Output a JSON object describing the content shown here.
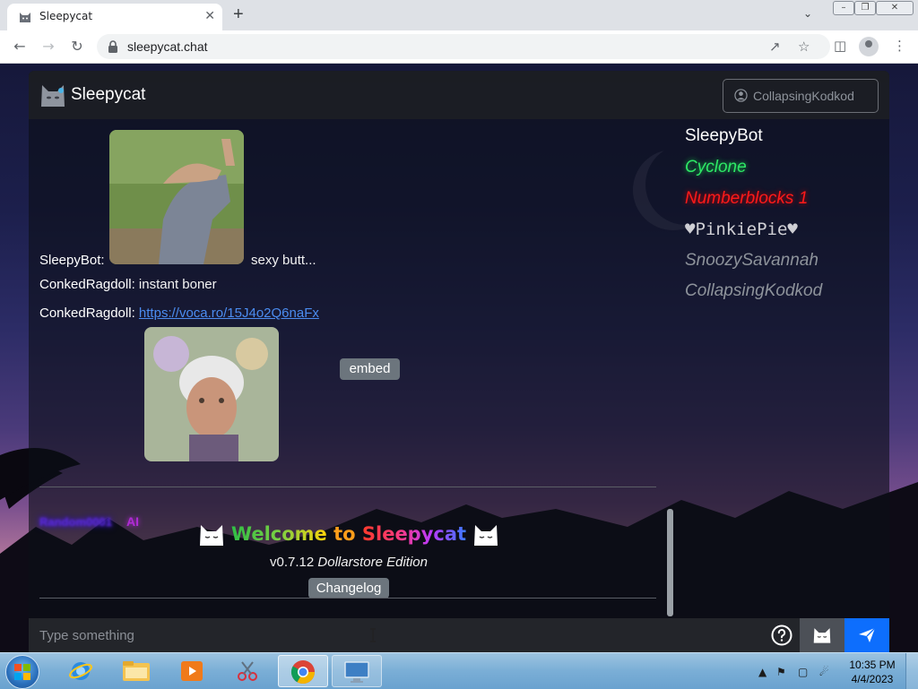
{
  "browser": {
    "tab_title": "Sleepycat",
    "tab_close": "✕",
    "new_tab": "+",
    "url": "sleepycat.chat",
    "window_controls": [
      "–",
      "❐",
      "✕"
    ]
  },
  "app": {
    "brand": "Sleepycat",
    "current_user": "CollapsingKodkod",
    "messages": [
      {
        "name": "SleepyBot:",
        "text": "sexy butt..."
      },
      {
        "name": "ConkedRagdoll:",
        "text": "instant boner"
      },
      {
        "name": "ConkedRagdoll:",
        "link": "https://voca.ro/15J4o2Q6naFx",
        "button": "embed"
      }
    ],
    "blurred_user_suffix": "AI",
    "welcome": {
      "title_parts": [
        "Welcome",
        " to ",
        "Sleepycat"
      ],
      "version_number": "v0.7.12",
      "version_name": "Dollarstore Edition",
      "changelog_button": "Changelog"
    },
    "users": [
      {
        "name": "SleepyBot",
        "color": "#ffffff"
      },
      {
        "name": "Cyclone",
        "color": "#2ee866"
      },
      {
        "name": "Numberblocks 1",
        "color": "#ff1a1a"
      },
      {
        "name": "PinkiePie",
        "color": "#cfcfd4"
      },
      {
        "name": "SnoozySavannah",
        "color": "#8e939b"
      },
      {
        "name": "CollapsingKodkod",
        "color": "#8e939b"
      }
    ],
    "input_placeholder": "Type something"
  },
  "taskbar": {
    "time": "10:35 PM",
    "date": "4/4/2023"
  },
  "colors": {
    "accent_blue": "#0d6efd",
    "link": "#4b8cf0",
    "secondary_button": "#6c757d"
  },
  "icons": [
    "cat-logo-icon",
    "user-circle-icon",
    "help-circle-icon",
    "cat-icon",
    "send-icon",
    "lock-icon",
    "share-icon",
    "star-icon",
    "sidebar-icon",
    "menu-icon"
  ]
}
